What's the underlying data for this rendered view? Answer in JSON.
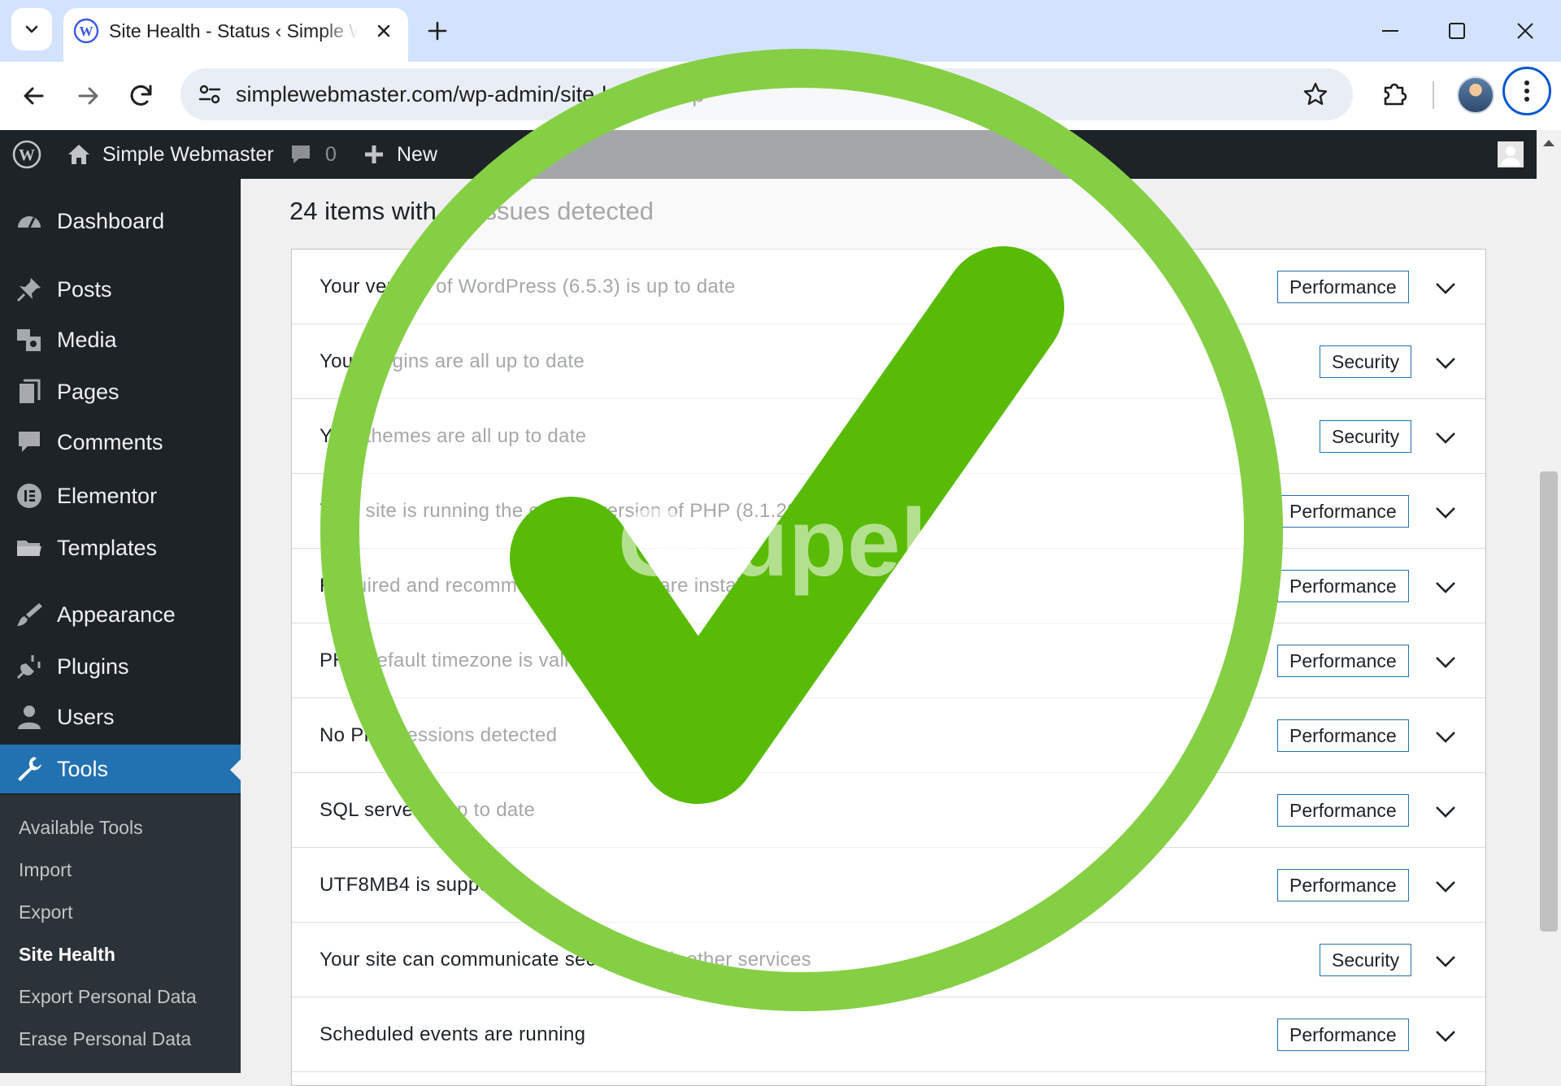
{
  "browser": {
    "tab_title": "Site Health - Status ‹ Simple Webmaster — WordPress",
    "url": "simplewebmaster.com/wp-admin/site-health.php",
    "accent_color": "#0b57d0",
    "tabstrip_color": "#d3e3fd"
  },
  "adminbar": {
    "site_name": "Simple Webmaster",
    "comments_count": "0",
    "new_label": "New",
    "icons": [
      "wordpress-logo-icon",
      "home-icon",
      "comment-bubble-icon",
      "plus-icon",
      "user-avatar-icon"
    ]
  },
  "sidebar": {
    "items": [
      {
        "label": "Dashboard",
        "icon": "dashboard-gauge-icon"
      },
      {
        "label": "Posts",
        "icon": "pushpin-icon"
      },
      {
        "label": "Media",
        "icon": "media-icon"
      },
      {
        "label": "Pages",
        "icon": "pages-icon"
      },
      {
        "label": "Comments",
        "icon": "comment-bubble-icon"
      },
      {
        "label": "Elementor",
        "icon": "elementor-icon"
      },
      {
        "label": "Templates",
        "icon": "folder-icon"
      },
      {
        "label": "Appearance",
        "icon": "paintbrush-icon"
      },
      {
        "label": "Plugins",
        "icon": "plug-icon"
      },
      {
        "label": "Users",
        "icon": "user-icon"
      },
      {
        "label": "Tools",
        "icon": "wrench-icon"
      }
    ],
    "submenu": [
      {
        "label": "Available Tools"
      },
      {
        "label": "Import"
      },
      {
        "label": "Export"
      },
      {
        "label": "Site Health"
      },
      {
        "label": "Export Personal Data"
      },
      {
        "label": "Erase Personal Data"
      }
    ],
    "current_item": "Tools",
    "current_subitem": "Site Health",
    "colors": {
      "background": "#1d2327",
      "submenu": "#2c3338",
      "current": "#2271b1"
    }
  },
  "main": {
    "heading": "24 items with no issues detected",
    "checks": [
      {
        "text": "Your version of WordPress (6.5.3) is up to date",
        "badge": "Performance"
      },
      {
        "text": "Your plugins are all up to date",
        "badge": "Security"
      },
      {
        "text": "Your themes are all up to date",
        "badge": "Security"
      },
      {
        "text": "Your site is running the current version of PHP (8.1.28)",
        "badge": "Performance"
      },
      {
        "text": "Required and recommended modules are installed",
        "badge": "Performance"
      },
      {
        "text": "PHP default timezone is valid",
        "badge": "Performance"
      },
      {
        "text": "No PHP sessions detected",
        "badge": "Performance"
      },
      {
        "text": "SQL server is up to date",
        "badge": "Performance"
      },
      {
        "text": "UTF8MB4 is supported",
        "badge": "Performance"
      },
      {
        "text": "Your site can communicate securely with other services",
        "badge": "Security"
      },
      {
        "text": "Scheduled events are running",
        "badge": "Performance"
      }
    ],
    "badge_border_color": "#2271b1"
  },
  "overlay": {
    "watermark_text": "Grupel",
    "check_color": "#58bb06",
    "ring_color": "#85cf45"
  }
}
